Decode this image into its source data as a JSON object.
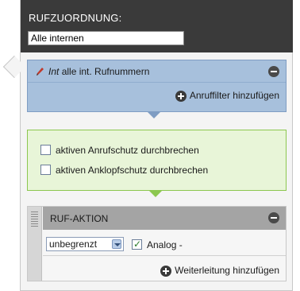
{
  "header": {
    "title": "RUFZUORDNUNG:",
    "input_value": "Alle internen"
  },
  "filter": {
    "prefix": "Int",
    "text": "alle int. Rufnummern",
    "add_label": "Anruffilter hinzufügen"
  },
  "options": {
    "items": [
      {
        "label": "aktiven Anrufschutz durchbrechen",
        "checked": false
      },
      {
        "label": "aktiven Anklopfschutz durchbrechen",
        "checked": false
      }
    ]
  },
  "action": {
    "title": "RUF-AKTION",
    "duration_value": "unbegrenzt",
    "analog_label": "Analog -",
    "analog_checked": true,
    "add_label": "Weiterleitung hinzufügen"
  },
  "colors": {
    "header_bg": "#3a3a3a",
    "filter_bg": "#a7c0dc",
    "options_bg": "#e8f5d8",
    "options_border": "#8cc74f",
    "action_header_bg": "#a4a4a4"
  }
}
